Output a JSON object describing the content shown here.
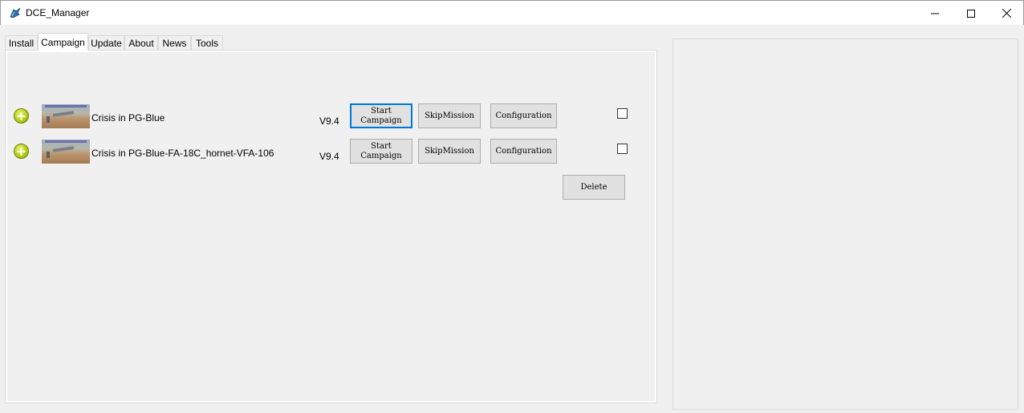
{
  "window": {
    "title": "DCE_Manager",
    "controls": {
      "minimize": "—",
      "maximize": "☐",
      "close": "✕"
    }
  },
  "tabs": [
    {
      "label": "Install"
    },
    {
      "label": "Campaign",
      "active": true
    },
    {
      "label": "Update"
    },
    {
      "label": "About"
    },
    {
      "label": "News"
    },
    {
      "label": "Tools"
    }
  ],
  "campaigns": [
    {
      "name": "Crisis in PG-Blue",
      "version": "V9.4",
      "start_label": "Start\nCampaign",
      "skip_label": "SkipMission",
      "config_label": "Configuration",
      "checked": false
    },
    {
      "name": "Crisis in PG-Blue-FA-18C_hornet-VFA-106",
      "version": "V9.4",
      "start_label": "Start\nCampaign",
      "skip_label": "SkipMission",
      "config_label": "Configuration",
      "checked": false
    }
  ],
  "actions": {
    "delete_label": "Delete"
  },
  "colors": {
    "focus_border": "#0078d7",
    "plus_icon": "#a6c20a"
  }
}
